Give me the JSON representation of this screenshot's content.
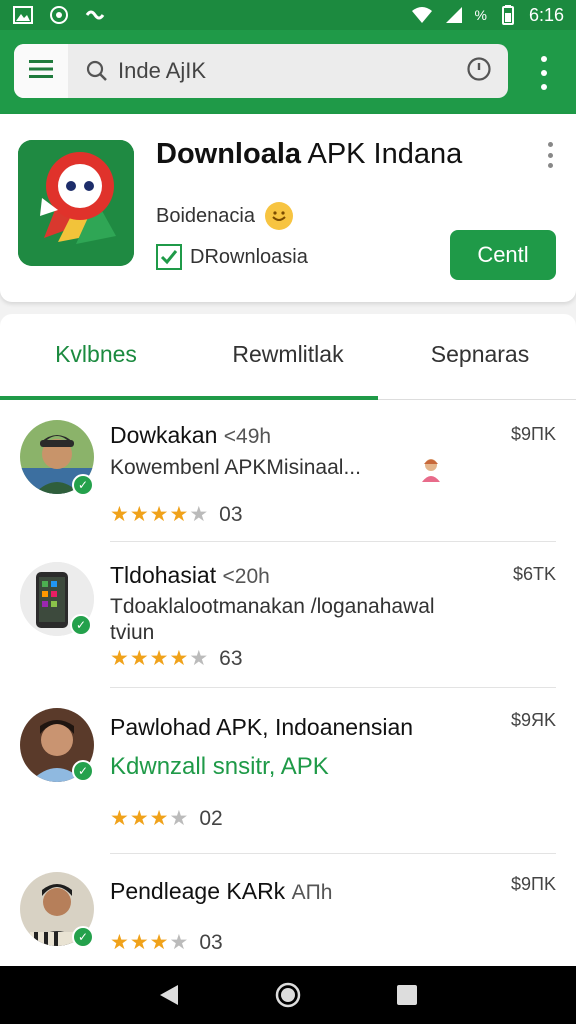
{
  "status_bar": {
    "battery": "%",
    "time": "6:16"
  },
  "search": {
    "query": "Inde AjIK"
  },
  "app": {
    "title_bold": "Downloala",
    "title_rest": " APK Indana",
    "subtitle": "Boidenacia",
    "checkbox_label": "DRownloasia",
    "install_label": "Centl"
  },
  "tabs": [
    {
      "label": "Kvlbnes",
      "active": true
    },
    {
      "label": "Rewmlitlak",
      "active": false
    },
    {
      "label": "Sepnaras",
      "active": false
    }
  ],
  "list": [
    {
      "title": "Dowkakan",
      "time": "<49h",
      "price": "$9ПK",
      "desc": "Kowembenl APKMisinaal...",
      "rating": 4,
      "count": "03"
    },
    {
      "title": "Tldohasiat",
      "time": "<20h",
      "price": "$6TK",
      "desc": "Tdoaklalootmanakan /loganahawal tviun",
      "rating": 4,
      "count": "63"
    },
    {
      "title": "Pawlohad APK, Indoanensian",
      "time": "",
      "price": "$9ЯK",
      "desc": "Kdwnzall snsitr, APK",
      "rating": 3,
      "count": "02"
    },
    {
      "title": "Pendleage KARk",
      "time": "AΠh",
      "price": "$9ПK",
      "desc": "",
      "rating": 3,
      "count": "03"
    }
  ],
  "colors": {
    "brand_green": "#1f9a48",
    "status_bar": "#1c8a3f",
    "star": "#f0a21a"
  }
}
